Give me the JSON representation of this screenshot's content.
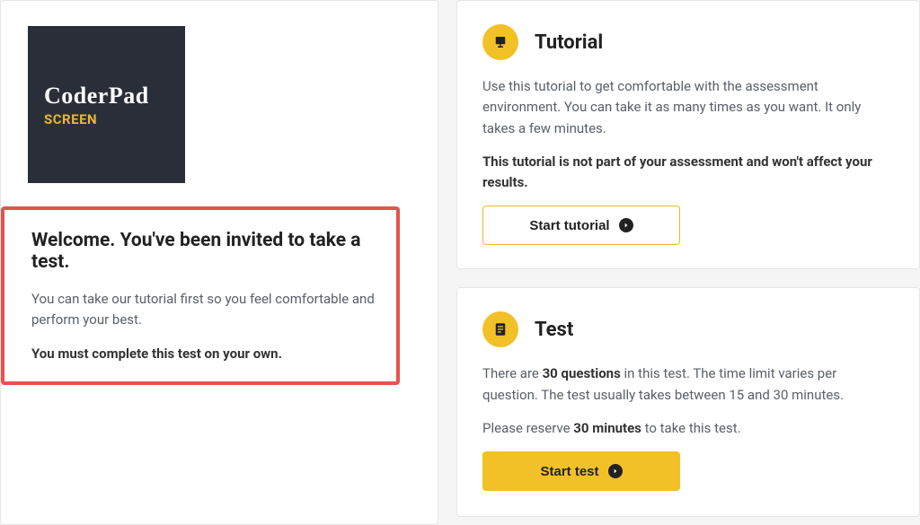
{
  "logo": {
    "main": "CoderPad",
    "sub": "SCREEN"
  },
  "welcome": {
    "title": "Welcome. You've been invited to take a test.",
    "desc": "You can take our tutorial first so you feel comfortable and perform your best.",
    "rule": "You must complete this test on your own."
  },
  "tutorial": {
    "title": "Tutorial",
    "desc": "Use this tutorial to get comfortable with the assessment environment. You can take it as many times as you want. It only takes a few minutes.",
    "notice": "This tutorial is not part of your assessment and won't affect your results.",
    "button": "Start tutorial"
  },
  "test": {
    "title": "Test",
    "line1_a": "There are ",
    "line1_b": "30 questions",
    "line1_c": " in this test. The time limit varies per question. The test usually takes between 15 and 30 minutes.",
    "line2_a": "Please reserve ",
    "line2_b": "30 minutes",
    "line2_c": " to take this test.",
    "button": "Start test"
  }
}
